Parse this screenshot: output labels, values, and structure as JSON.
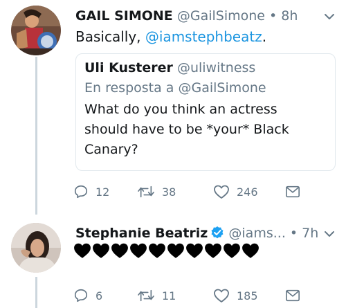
{
  "tweet1": {
    "name": "GAIL SIMONE",
    "handle": "@GailSimone",
    "separator": "•",
    "time": "8h",
    "text_prefix": "Basically,",
    "mention": "@iamstephbeatz",
    "text_suffix": ".",
    "quoted": {
      "name": "Uli Kusterer",
      "handle": "@uliwitness",
      "reply_to": "En resposta a @GailSimone",
      "text": "What do you think an actress\nshould have to be *your* Black\nCanary?"
    },
    "actions": {
      "replies": "12",
      "retweets": "38",
      "likes": "246"
    }
  },
  "tweet2": {
    "name": "Stephanie Beatriz",
    "handle": "@iams...",
    "separator": "•",
    "time": "7h",
    "hearts": 10,
    "heart_color": "#000000",
    "actions": {
      "replies": "6",
      "retweets": "11",
      "likes": "185"
    }
  },
  "colors": {
    "link": "#1b95e0",
    "muted": "#657786",
    "verified": "#1da1f2",
    "border": "#e1e8ed"
  },
  "icons": [
    "reply-icon",
    "retweet-icon",
    "like-icon",
    "dm-icon",
    "verified-badge-icon",
    "chevron-down-icon"
  ]
}
